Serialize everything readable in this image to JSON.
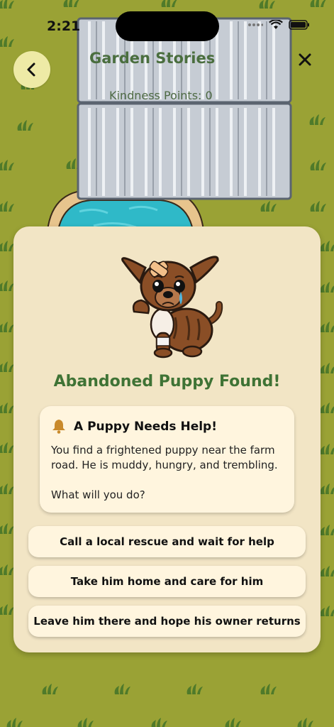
{
  "status": {
    "time": "2:21"
  },
  "header": {
    "title": "Garden Stories",
    "points": "Kindness Points: 0"
  },
  "story": {
    "heading": "Abandoned Puppy Found!",
    "message_title": "A Puppy Needs Help!",
    "message_body": "You find a frightened puppy near the farm road. He is muddy, hungry, and trembling.",
    "message_prompt": "What will you do?"
  },
  "choices": [
    {
      "label": "Call a local rescue and wait for help"
    },
    {
      "label": "Take him home and care for him"
    },
    {
      "label": "Leave him there and hope his owner returns"
    }
  ],
  "colors": {
    "background": "#9aa235",
    "card": "#f2e5c5",
    "heading": "#3f7335",
    "button": "#fff5de"
  },
  "icons": {
    "back": "chevron-left-icon",
    "close": "close-icon",
    "bell": "bell-icon"
  }
}
